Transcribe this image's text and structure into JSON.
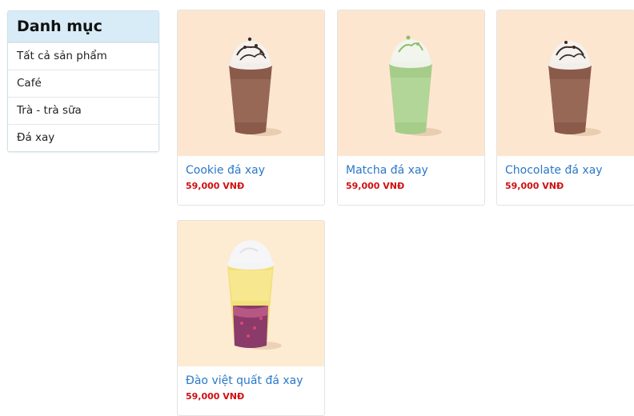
{
  "sidebar": {
    "title": "Danh mục",
    "items": [
      {
        "label": "Tất cả sản phẩm"
      },
      {
        "label": "Café"
      },
      {
        "label": "Trà - trà sữa"
      },
      {
        "label": "Đá xay"
      }
    ]
  },
  "products": [
    {
      "name": "Cookie đá xay",
      "price": "59,000 VNĐ",
      "drink": "cookie-frappe"
    },
    {
      "name": "Matcha đá xay",
      "price": "59,000 VNĐ",
      "drink": "matcha-frappe"
    },
    {
      "name": "Chocolate đá xay",
      "price": "59,000 VNĐ",
      "drink": "chocolate-frappe"
    },
    {
      "name": "Đào việt quất đá xay",
      "price": "59,000 VNĐ",
      "drink": "peach-blueberry-frappe"
    }
  ],
  "colors": {
    "accent_link": "#2a78c8",
    "price": "#d00f10",
    "sidebar_header": "#d7ecf7",
    "card_image_bg": "#fde6d0"
  }
}
